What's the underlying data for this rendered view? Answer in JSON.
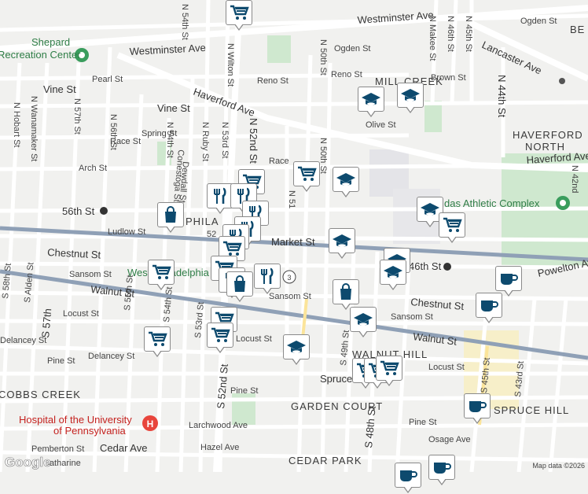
{
  "map": {
    "attribution": "Map data ©2026",
    "logo": "Google",
    "neighborhoods": [
      "MILL CREEK",
      "HAVERFORD",
      "NORTH",
      "WALNUT HILL",
      "GARDEN COURT",
      "CEDAR PARK",
      "COBBS CREEK",
      "SPRUCE HILL",
      "PHILA",
      "BE"
    ],
    "streets": {
      "westminster": "Westminster Ave",
      "haverford": "Haverford Ave",
      "vine": "Vine St",
      "pearl": "Pearl St",
      "ogden": "Ogden St",
      "reno": "Reno St",
      "brown": "Brown St",
      "olive": "Olive St",
      "spring": "Spring St",
      "race": "Race St",
      "race2": "Race",
      "arch": "Arch St",
      "ludlow": "Ludlow St",
      "market": "Market St",
      "chestnut": "Chestnut St",
      "sansom": "Sansom St",
      "sansom2": "Sansom St",
      "walnut": "Walnut St",
      "walnut2": "Walnut St",
      "locust": "Locust St",
      "locust2": "Locust St",
      "delancey": "Delancey St",
      "delancey2": "Delancey St",
      "pine": "Pine St",
      "pine2": "Pine St",
      "pine3": "Pine St",
      "spruce": "Spruce St",
      "larchwood": "Larchwood Ave",
      "cedar": "Cedar Ave",
      "hazel": "Hazel Ave",
      "osage": "Osage Ave",
      "pemberton": "Pemberton St",
      "catharine": "Catharine",
      "lancaster": "Lancaster Ave",
      "powelton": "Powelton Av",
      "hobart": "N Hobart St",
      "wanamaker": "N Wanamaker St",
      "n57": "N 57th St",
      "n56": "N 56th St",
      "n54": "N 54th St",
      "ruby": "N Ruby St",
      "n53": "N 53rd St",
      "n52": "N 52nd St",
      "wilton": "N Wilton St",
      "n51": "N 51",
      "n50": "N 50th St",
      "n46": "N 46th St",
      "n45": "N 45th St",
      "makee": "N Makee St",
      "n44": "N 44th St",
      "n42": "N 42nd",
      "conestoga": "Conestoga St",
      "dewdall": "Dewdall St",
      "s58": "S 58th St",
      "alden": "S Alden St",
      "s57": "S 57th",
      "s55": "S 55th St",
      "s54": "S 54th St",
      "s53": "S 53rd St",
      "s52": "S 52nd St",
      "s49": "S 49th St",
      "s48": "S 48th St",
      "s45": "S 45th St",
      "s43": "S 43rd St",
      "n54top": "N 54th St",
      "hill": "hill St"
    },
    "places": {
      "shepard": "Shepard",
      "shepard2": "Recreation Center",
      "athletic": "das Athletic Complex",
      "hospital": "Hospital of the University",
      "hospital2": "of Pennsylvania",
      "westphila": "West Philadelphia",
      "olive_partial": "A",
      "s56th": "56th St",
      "s46th": "46th St",
      "phila52": "52"
    },
    "route": "3",
    "colors": {
      "transit_line": "#8fa0b6",
      "park": "#c8e6c9",
      "marker_icon": "#0d4a6e",
      "hospital": "#e8453c",
      "poi_green": "#3a9d5d"
    }
  }
}
